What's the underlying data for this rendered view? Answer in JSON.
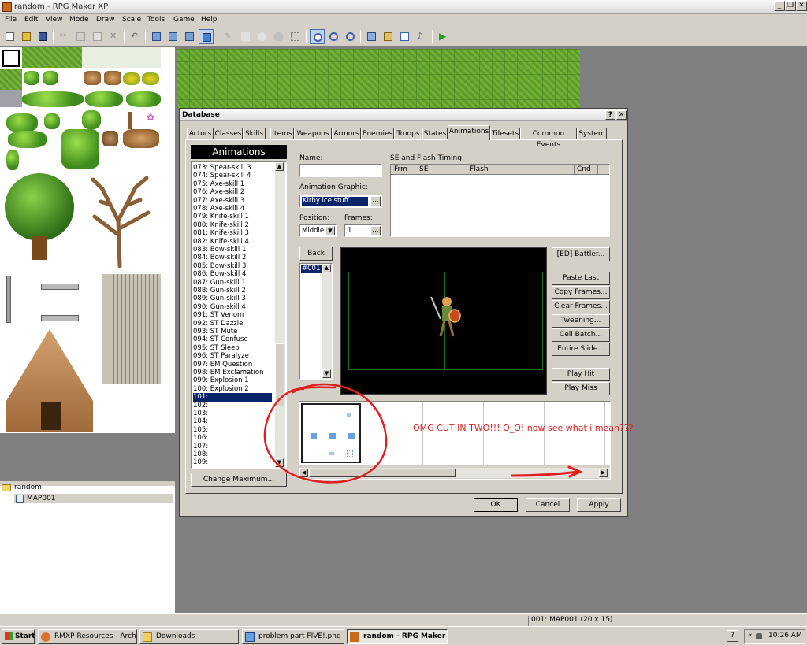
{
  "window": {
    "title": "random - RPG Maker XP",
    "controls": [
      "_",
      "❐",
      "✕"
    ]
  },
  "menu": [
    "File",
    "Edit",
    "View",
    "Mode",
    "Draw",
    "Scale",
    "Tools",
    "Game",
    "Help"
  ],
  "toolbar": {
    "icons": [
      "new-project-icon",
      "open-project-icon",
      "save-icon",
      "cut-icon",
      "copy-icon",
      "paste-icon",
      "delete-icon",
      "undo-icon",
      "layer1-icon",
      "layer2-icon",
      "layer3-icon",
      "events-icon",
      "pencil-icon",
      "rectangle-icon",
      "ellipse-icon",
      "flood-fill-icon",
      "select-icon",
      "zoom-1-icon",
      "zoom-1-2-icon",
      "zoom-1-4-icon",
      "database-icon",
      "materialbase-icon",
      "script-editor-icon",
      "sound-test-icon",
      "playtest-icon"
    ]
  },
  "maptree": {
    "root": "random",
    "maps": [
      "MAP001"
    ]
  },
  "database": {
    "title": "Database",
    "title_controls": [
      "?",
      "✕"
    ],
    "tabs": [
      "Actors",
      "Classes",
      "Skills",
      "Items",
      "Weapons",
      "Armors",
      "Enemies",
      "Troops",
      "States",
      "Animations",
      "Tilesets",
      "Common Events",
      "System"
    ],
    "active_tab": "Animations",
    "list_header": "Animations",
    "list": [
      "073: Spear-skill 3",
      "074: Spear-skill 4",
      "075: Axe-skill 1",
      "076: Axe-skill 2",
      "077: Axe-skill 3",
      "078: Axe-skill 4",
      "079: Knife-skill 1",
      "080: Knife-skill 2",
      "081: Knife-skill 3",
      "082: Knife-skill 4",
      "083: Bow-skill 1",
      "084: Bow-skill 2",
      "085: Bow-skill 3",
      "086: Bow-skill 4",
      "087: Gun-skill 1",
      "088: Gun-skill 2",
      "089: Gun-skill 3",
      "090: Gun-skill 4",
      "091: ST Venom",
      "092: ST Dazzle",
      "093: ST Mute",
      "094: ST Confuse",
      "095: ST Sleep",
      "096: ST Paralyze",
      "097: EM Question",
      "098: EM Exclamation",
      "099: Explosion 1",
      "100: Explosion 2",
      "101:",
      "102:",
      "103:",
      "104:",
      "105:",
      "106:",
      "107:",
      "108:",
      "109:"
    ],
    "selected_item": "101:",
    "change_maximum": "Change Maximum...",
    "name_label": "Name:",
    "name_value": "",
    "graphic_label": "Animation Graphic:",
    "graphic_value": "Kirby ice stuff",
    "position_label": "Position:",
    "position_value": "Middle",
    "frames_label": "Frames:",
    "frames_value": "1",
    "se_label": "SE and Flash Timing:",
    "se_columns": [
      "Frm",
      "SE",
      "Flash",
      "Cnd"
    ],
    "back_button": "Back",
    "frame_list": [
      "#001"
    ],
    "side_buttons": [
      "[ED] Battler...",
      "Paste Last",
      "Copy Frames...",
      "Clear Frames...",
      "Tweening...",
      "Cell Batch...",
      "Entire Slide..."
    ],
    "play_hit": "Play Hit",
    "play_miss": "Play Miss",
    "ok": "OK",
    "cancel": "Cancel",
    "apply": "Apply"
  },
  "annotation": {
    "text": "OMG CUT IN TWO!!! O_O! now see what i mean???",
    "color": "#e02020"
  },
  "status": {
    "map_info": "001: MAP001 (20 x 15)"
  },
  "taskbar": {
    "start": "Start",
    "tasks": [
      "RMXP Resources - Archiv...",
      "Downloads",
      "problem part FIVE!.png (...",
      "random - RPG Maker ..."
    ],
    "active_task": "random - RPG Maker ...",
    "tray_glyphs": [
      "?",
      "«"
    ],
    "time": "10:26 AM"
  },
  "colors": {
    "selection": "#0a246a",
    "dialog_bg": "#d4d0c8",
    "editor_bg": "#808080",
    "annotation": "#e02020"
  }
}
